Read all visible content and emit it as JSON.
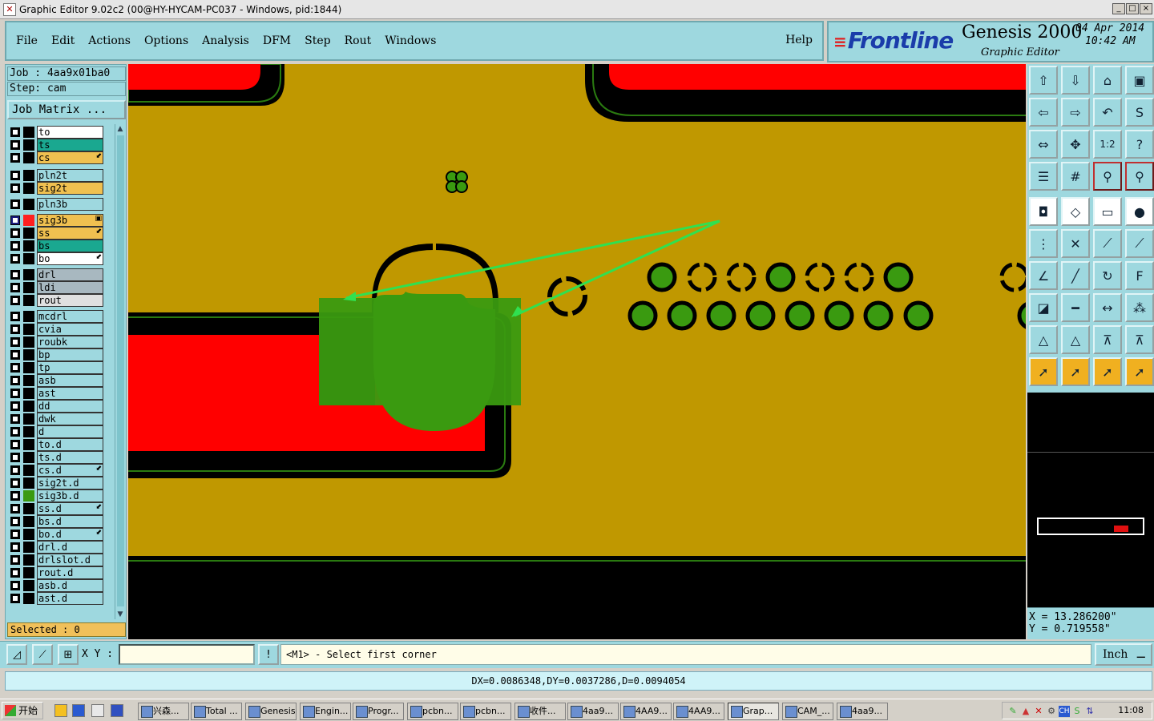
{
  "window": {
    "title": "Graphic Editor 9.02c2 (00@HY-HYCAM-PC037 - Windows, pid:1844)",
    "controls": [
      "_",
      "□",
      "×"
    ]
  },
  "menu": {
    "items": [
      "File",
      "Edit",
      "Actions",
      "Options",
      "Analysis",
      "DFM",
      "Step",
      "Rout",
      "Windows"
    ],
    "help": "Help"
  },
  "brand": {
    "logo": "Frontline",
    "product": "Genesis 2000",
    "subtitle": "Graphic Editor",
    "date": "04 Apr 2014",
    "time": "10:42 AM"
  },
  "left_panel": {
    "job": "Job : 4aa9x01ba0",
    "step": "Step: cam",
    "job_matrix": "Job Matrix ...",
    "selected": "Selected : 0",
    "layers": [
      {
        "name": "to",
        "color": "#ffffff",
        "swatch": "#000000",
        "mark": ""
      },
      {
        "name": "ts",
        "color": "#1aa890",
        "swatch": "#000000",
        "mark": ""
      },
      {
        "name": "cs",
        "color": "#f0c050",
        "swatch": "#000000",
        "mark": "⬋"
      },
      {
        "name": "pln2t",
        "color": "#9ed8df",
        "swatch": "#000000",
        "mark": ""
      },
      {
        "name": "sig2t",
        "color": "#f0c050",
        "swatch": "#000000",
        "mark": ""
      },
      {
        "name": "pln3b",
        "color": "#9ed8df",
        "swatch": "#000000",
        "mark": ""
      },
      {
        "name": "sig3b",
        "color": "#f0c050",
        "swatch": "#ff2020",
        "mark": "▣",
        "active": true
      },
      {
        "name": "ss",
        "color": "#f0c050",
        "swatch": "#000000",
        "mark": "⬋"
      },
      {
        "name": "bs",
        "color": "#1aa890",
        "swatch": "#000000",
        "mark": ""
      },
      {
        "name": "bo",
        "color": "#ffffff",
        "swatch": "#000000",
        "mark": "⬋"
      },
      {
        "name": "drl",
        "color": "#a8b8c0",
        "swatch": "#000000",
        "mark": ""
      },
      {
        "name": "ldi",
        "color": "#a8b8c0",
        "swatch": "#000000",
        "mark": ""
      },
      {
        "name": "rout",
        "color": "#e0e0e0",
        "swatch": "#000000",
        "mark": ""
      },
      {
        "name": "mcdrl",
        "color": "#9ed8df",
        "swatch": "#000000",
        "mark": ""
      },
      {
        "name": "cvia",
        "color": "#9ed8df",
        "swatch": "#000000",
        "mark": ""
      },
      {
        "name": "roubk",
        "color": "#9ed8df",
        "swatch": "#000000",
        "mark": ""
      },
      {
        "name": "bp",
        "color": "#9ed8df",
        "swatch": "#000000",
        "mark": ""
      },
      {
        "name": "tp",
        "color": "#9ed8df",
        "swatch": "#000000",
        "mark": ""
      },
      {
        "name": "asb",
        "color": "#9ed8df",
        "swatch": "#000000",
        "mark": ""
      },
      {
        "name": "ast",
        "color": "#9ed8df",
        "swatch": "#000000",
        "mark": ""
      },
      {
        "name": "dd",
        "color": "#9ed8df",
        "swatch": "#000000",
        "mark": ""
      },
      {
        "name": "dwk",
        "color": "#9ed8df",
        "swatch": "#000000",
        "mark": ""
      },
      {
        "name": "d",
        "color": "#9ed8df",
        "swatch": "#000000",
        "mark": ""
      },
      {
        "name": "to.d",
        "color": "#9ed8df",
        "swatch": "#000000",
        "mark": ""
      },
      {
        "name": "ts.d",
        "color": "#9ed8df",
        "swatch": "#000000",
        "mark": ""
      },
      {
        "name": "cs.d",
        "color": "#9ed8df",
        "swatch": "#000000",
        "mark": "⬋"
      },
      {
        "name": "sig2t.d",
        "color": "#9ed8df",
        "swatch": "#000000",
        "mark": ""
      },
      {
        "name": "sig3b.d",
        "color": "#9ed8df",
        "swatch": "#3a9a10",
        "mark": ""
      },
      {
        "name": "ss.d",
        "color": "#9ed8df",
        "swatch": "#000000",
        "mark": "⬋"
      },
      {
        "name": "bs.d",
        "color": "#9ed8df",
        "swatch": "#000000",
        "mark": ""
      },
      {
        "name": "bo.d",
        "color": "#9ed8df",
        "swatch": "#000000",
        "mark": "⬋"
      },
      {
        "name": "drl.d",
        "color": "#9ed8df",
        "swatch": "#000000",
        "mark": ""
      },
      {
        "name": "drlslot.d",
        "color": "#9ed8df",
        "swatch": "#000000",
        "mark": ""
      },
      {
        "name": "rout.d",
        "color": "#9ed8df",
        "swatch": "#000000",
        "mark": ""
      },
      {
        "name": "asb.d",
        "color": "#9ed8df",
        "swatch": "#000000",
        "mark": ""
      },
      {
        "name": "ast.d",
        "color": "#9ed8df",
        "swatch": "#000000",
        "mark": ""
      }
    ]
  },
  "canvas": {
    "colors": {
      "board": "#c09800",
      "copper_red": "#ff0000",
      "pad_green": "#3a9a10",
      "arrow": "#30e050",
      "outline": "#2a7a10"
    }
  },
  "toolbox": {
    "buttons": [
      {
        "icon": "zoom-home-up-icon",
        "glyph": "⇧",
        "style": ""
      },
      {
        "icon": "zoom-home-down-icon",
        "glyph": "⇩",
        "style": ""
      },
      {
        "icon": "home-icon",
        "glyph": "⌂",
        "style": ""
      },
      {
        "icon": "fit-window-icon",
        "glyph": "▣",
        "style": ""
      },
      {
        "icon": "pan-left-icon",
        "glyph": "⇦",
        "style": ""
      },
      {
        "icon": "pan-right-icon",
        "glyph": "⇨",
        "style": ""
      },
      {
        "icon": "undo-icon",
        "glyph": "↶",
        "style": ""
      },
      {
        "icon": "redraw-icon",
        "glyph": "S",
        "style": ""
      },
      {
        "icon": "zoom-extents-icon",
        "glyph": "⇔",
        "style": ""
      },
      {
        "icon": "center-icon",
        "glyph": "✥",
        "style": ""
      },
      {
        "icon": "scale-1-2-icon",
        "glyph": "1:2",
        "style": ""
      },
      {
        "icon": "help-icon",
        "glyph": "?",
        "style": ""
      },
      {
        "icon": "layer-settings-icon",
        "glyph": "☰",
        "style": ""
      },
      {
        "icon": "grid-icon",
        "glyph": "#",
        "style": ""
      },
      {
        "icon": "snap-red-icon",
        "glyph": "⚲",
        "style": "red"
      },
      {
        "icon": "snap-red-alt-icon",
        "glyph": "⚲",
        "style": "red"
      },
      {
        "icon": "select-feature-icon",
        "glyph": "◘",
        "style": "white"
      },
      {
        "icon": "edit-shape-icon",
        "glyph": "◇",
        "style": "white"
      },
      {
        "icon": "ruler-icon",
        "glyph": "▭",
        "style": "white"
      },
      {
        "icon": "pad-icon",
        "glyph": "●",
        "style": "white"
      },
      {
        "icon": "connect-icon",
        "glyph": "⋮",
        "style": ""
      },
      {
        "icon": "cross-icon",
        "glyph": "✕",
        "style": ""
      },
      {
        "icon": "line-node-icon",
        "glyph": "⟋",
        "style": ""
      },
      {
        "icon": "line-node-red-icon",
        "glyph": "⟋",
        "style": ""
      },
      {
        "icon": "angle-icon",
        "glyph": "∠",
        "style": ""
      },
      {
        "icon": "diagonal-line-icon",
        "glyph": "╱",
        "style": ""
      },
      {
        "icon": "arc-icon",
        "glyph": "↻",
        "style": ""
      },
      {
        "icon": "text-f-icon",
        "glyph": "F",
        "style": ""
      },
      {
        "icon": "add-pad-icon",
        "glyph": "◪",
        "style": ""
      },
      {
        "icon": "line-icon",
        "glyph": "━",
        "style": ""
      },
      {
        "icon": "dimension-icon",
        "glyph": "↔",
        "style": ""
      },
      {
        "icon": "pads-group-icon",
        "glyph": "⁂",
        "style": ""
      },
      {
        "icon": "triangle-red-icon",
        "glyph": "△",
        "style": ""
      },
      {
        "icon": "triangle-icon",
        "glyph": "△",
        "style": ""
      },
      {
        "icon": "triangle-measure-icon",
        "glyph": "⊼",
        "style": ""
      },
      {
        "icon": "triangle-measure-alt-icon",
        "glyph": "⊼",
        "style": ""
      },
      {
        "icon": "pointer-icon",
        "glyph": "➚",
        "style": "orange"
      },
      {
        "icon": "pointer-select-icon",
        "glyph": "➚",
        "style": "orange"
      },
      {
        "icon": "pointer-move-icon",
        "glyph": "➚",
        "style": "orange"
      },
      {
        "icon": "pointer-net-icon",
        "glyph": "➚",
        "style": "orange"
      }
    ],
    "coords_x": "X = 13.286200\"",
    "coords_y": "Y = 0.719558\""
  },
  "command": {
    "xy_label": "X Y :",
    "xy_value": "",
    "prompt": "<M1> - Select first corner",
    "unit": "Inch"
  },
  "measure": {
    "text": "DX=0.0086348,DY=0.0037286,D=0.0094054"
  },
  "taskbar": {
    "start": "开始",
    "tasks": [
      "兴森...",
      "Total ...",
      "Genesis",
      "Engin...",
      "Progr...",
      "pcbn...",
      "pcbn...",
      "收件...",
      "4aa9...",
      "4AA9...",
      "4AA9...",
      "Grap...",
      "CAM_...",
      "4aa9..."
    ],
    "active_task": "Grap...",
    "tray_ime": "CH",
    "clock": "11:08"
  }
}
